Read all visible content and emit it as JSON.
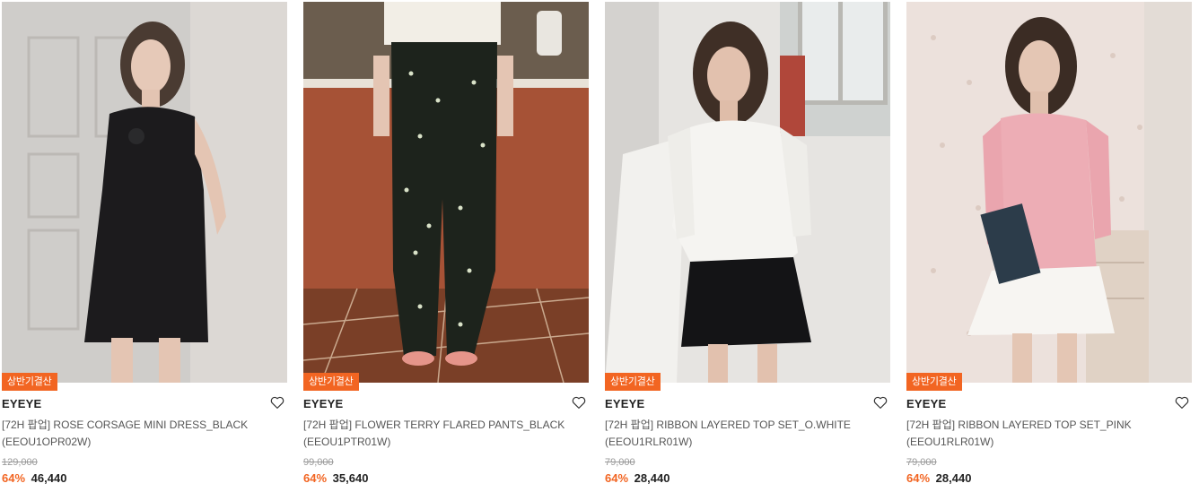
{
  "products": [
    {
      "badge": "상반기결산",
      "brand": "EYEYE",
      "name": "[72H 팝업] ROSE CORSAGE MINI DRESS_BLACK",
      "code": "(EEOU1OPR02W)",
      "original_price": "129,000",
      "discount": "64%",
      "price": "46,440",
      "photo_icon": "black-mini-dress-photo"
    },
    {
      "badge": "상반기결산",
      "brand": "EYEYE",
      "name": "[72H 팝업] FLOWER TERRY FLARED PANTS_BLACK",
      "code": "(EEOU1PTR01W)",
      "original_price": "99,000",
      "discount": "64%",
      "price": "35,640",
      "photo_icon": "floral-pants-photo"
    },
    {
      "badge": "상반기결산",
      "brand": "EYEYE",
      "name": "[72H 팝업] RIBBON LAYERED TOP SET_O.WHITE",
      "code": "(EEOU1RLR01W)",
      "original_price": "79,000",
      "discount": "64%",
      "price": "28,440",
      "photo_icon": "white-top-photo"
    },
    {
      "badge": "상반기결산",
      "brand": "EYEYE",
      "name": "[72H 팝업] RIBBON LAYERED TOP SET_PINK",
      "code": "(EEOU1RLR01W)",
      "original_price": "79,000",
      "discount": "64%",
      "price": "28,440",
      "photo_icon": "pink-top-photo"
    }
  ],
  "colors": {
    "accent": "#f26522",
    "text": "#222222",
    "muted": "#999999"
  }
}
